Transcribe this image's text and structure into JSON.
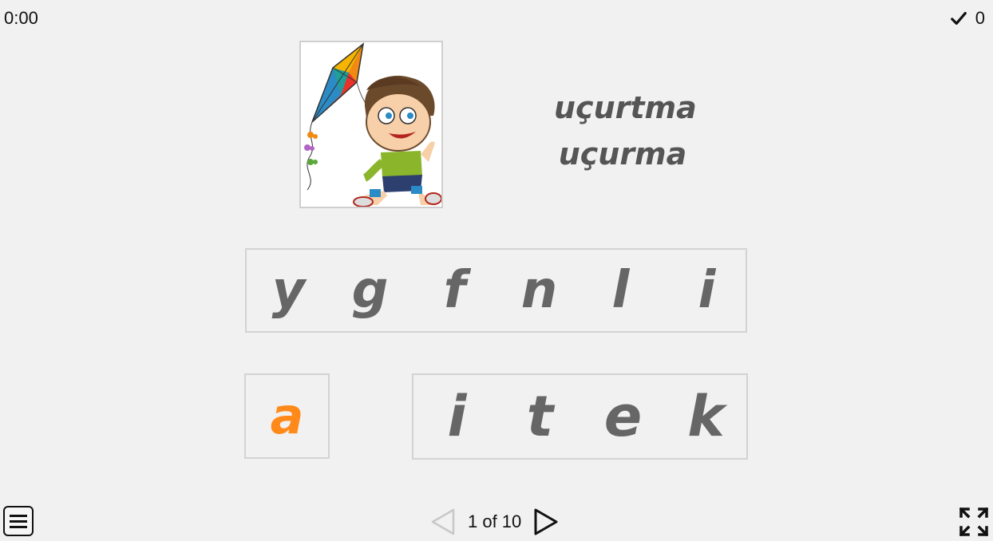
{
  "timer": "0:00",
  "score": "0",
  "word_options": [
    "uçurtma",
    "uçurma"
  ],
  "letter_bank": [
    "y",
    "g",
    "f",
    "n",
    "l",
    "i"
  ],
  "answer_slot": "a",
  "answer_letters": [
    "i",
    "t",
    "e",
    "k"
  ],
  "pager": "1 of 10",
  "colors": {
    "placed_letter": "#ff8a1a",
    "tile_text": "#666666"
  }
}
